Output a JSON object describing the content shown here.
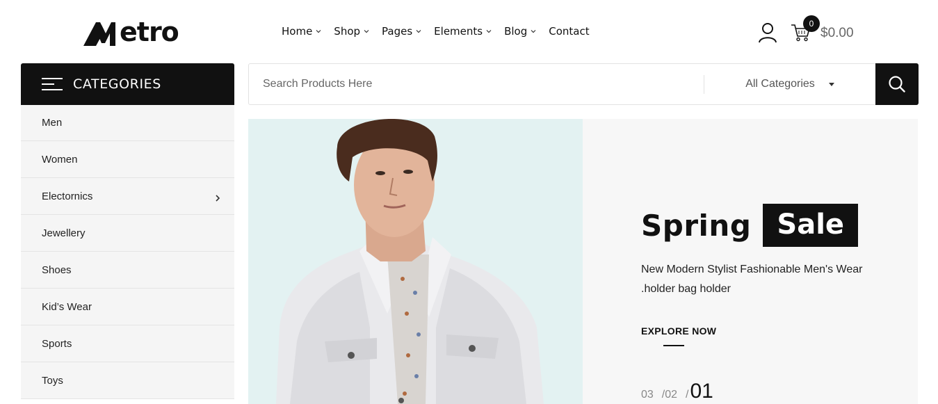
{
  "header": {
    "logo_text": "etro",
    "logo_alt": "Metro",
    "nav": [
      {
        "label": "Home",
        "has_dropdown": true
      },
      {
        "label": "Shop",
        "has_dropdown": true
      },
      {
        "label": "Pages",
        "has_dropdown": true
      },
      {
        "label": "Elements",
        "has_dropdown": true
      },
      {
        "label": "Blog",
        "has_dropdown": true
      },
      {
        "label": "Contact",
        "has_dropdown": false
      }
    ],
    "cart_count": "0",
    "cart_total": "$0.00",
    "icons": {
      "account": "user-icon",
      "cart": "cart-icon"
    }
  },
  "categories": {
    "title": "CATEGORIES",
    "items": [
      {
        "label": "Men"
      },
      {
        "label": "Women"
      },
      {
        "label": "Electornics",
        "has_submenu": true
      },
      {
        "label": "Jewellery"
      },
      {
        "label": "Shoes"
      },
      {
        "label": "Kid’s Wear"
      },
      {
        "label": "Sports"
      },
      {
        "label": "Toys"
      }
    ]
  },
  "search": {
    "placeholder": "Search Products Here",
    "value": "",
    "category_select": "All Categories",
    "button_icon": "search-icon"
  },
  "hero": {
    "title_plain": "Spring",
    "title_boxed": "Sale",
    "description": "New Modern Stylist Fashionable Men's Wear .holder bag holder",
    "cta_label": "EXPLORE NOW",
    "pager": {
      "slide_3": "03",
      "slide_2": "/02",
      "current_prefix": "/",
      "current": "01"
    },
    "image_subject": "man-in-white-denim-jacket",
    "colors": {
      "image_bg": "#e3f2f2",
      "panel_bg": "#f7f7f7"
    }
  },
  "colors": {
    "primary_dark": "#111111",
    "sidebar_bg": "#f5f5f5",
    "border": "#e2e2e2"
  }
}
